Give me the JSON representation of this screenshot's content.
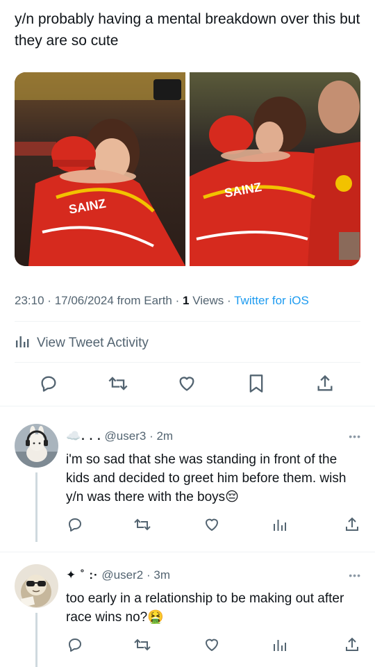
{
  "tweet": {
    "text": "y/n probably having a mental breakdown over this but they are so cute",
    "photos": [
      {
        "alt": "photo-hug-left",
        "jersey_text": "SAINZ"
      },
      {
        "alt": "photo-hug-right",
        "jersey_text": "SAINZ"
      }
    ],
    "time": "23:10",
    "date": "17/06/2024",
    "location": "from Earth",
    "views_count": "1",
    "views_label": "Views",
    "source": "Twitter for iOS",
    "sep": "·"
  },
  "activity": {
    "label": "View Tweet Activity"
  },
  "actions": [
    "reply-icon",
    "retweet-icon",
    "like-icon",
    "bookmark-icon",
    "share-icon"
  ],
  "replies": [
    {
      "name": "☁️. . .",
      "handle": "@user3",
      "time": "2m",
      "text": "i'm so sad that she was standing in front of the kids and decided to greet him before them. wish y/n was there with the boys😔",
      "more": "•••"
    },
    {
      "name": "✦ ˚ :·",
      "handle": "@user2",
      "time": "3m",
      "text": "too early in a relationship to be making out after race wins no?🤮",
      "more": "•••"
    }
  ],
  "colors": {
    "text": "#0f1419",
    "muted": "#536471",
    "accent": "#1d9bf0",
    "divider": "#eff3f4",
    "ferrari_red": "#d62a1e"
  }
}
